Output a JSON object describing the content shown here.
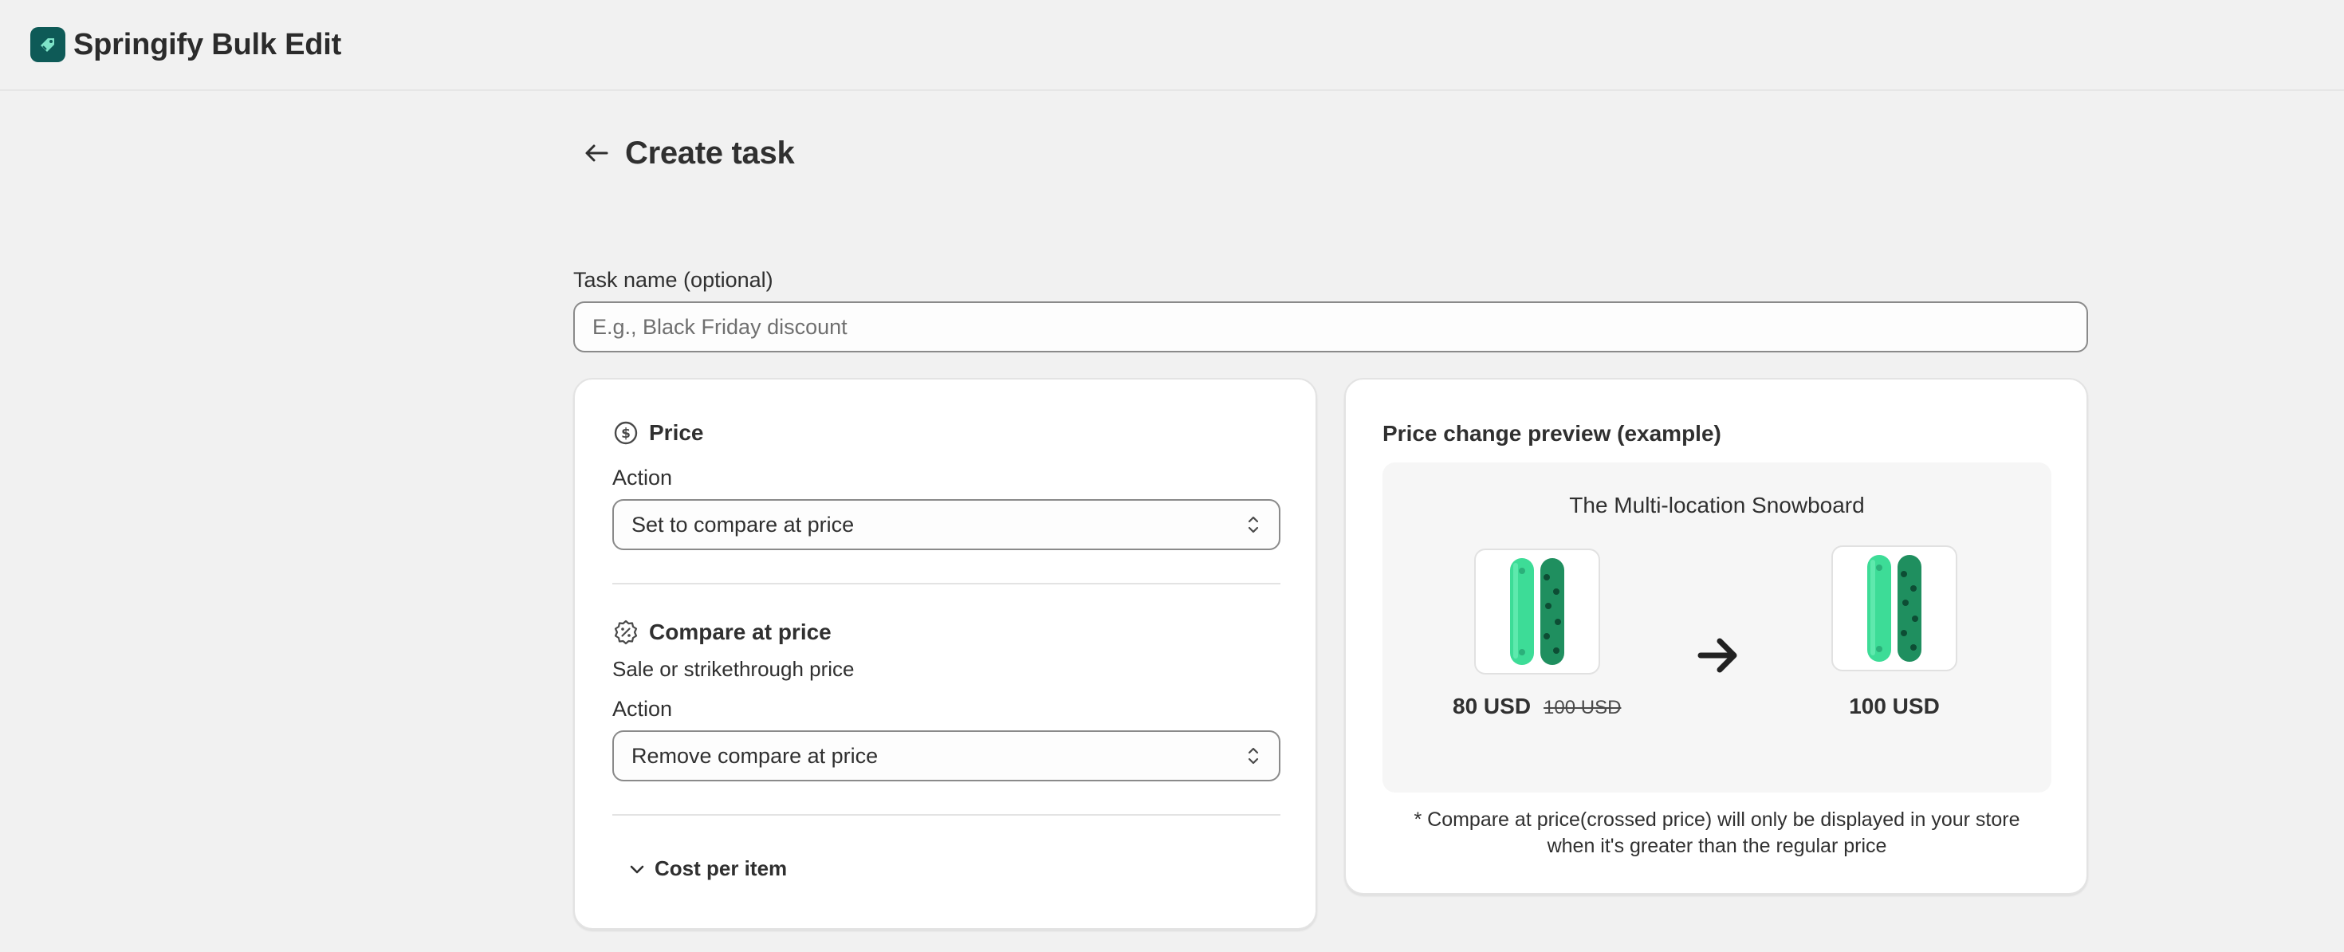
{
  "app": {
    "title": "Springify Bulk Edit",
    "logo_icon": "tag-leaf-icon",
    "brand_color": "#0e5a57"
  },
  "header": {
    "title": "Create task",
    "back_icon": "arrow-left-icon"
  },
  "task_name": {
    "label": "Task name (optional)",
    "placeholder": "E.g., Black Friday discount",
    "value": ""
  },
  "price_section": {
    "title": "Price",
    "icon": "dollar-circle-icon",
    "action_label": "Action",
    "action_value": "Set to compare at price"
  },
  "compare_section": {
    "title": "Compare at price",
    "icon": "discount-badge-icon",
    "description": "Sale or strikethrough price",
    "action_label": "Action",
    "action_value": "Remove compare at price"
  },
  "cost_section": {
    "label": "Cost per item",
    "icon": "chevron-down-icon"
  },
  "preview": {
    "title": "Price change preview (example)",
    "product_name": "The Multi-location Snowboard",
    "before_price": "80 USD",
    "before_compare": "100 USD",
    "after_price": "100 USD",
    "note_line1": "* Compare at price(crossed price) will only be displayed in your store",
    "note_line2": "when it's greater than the regular price"
  }
}
